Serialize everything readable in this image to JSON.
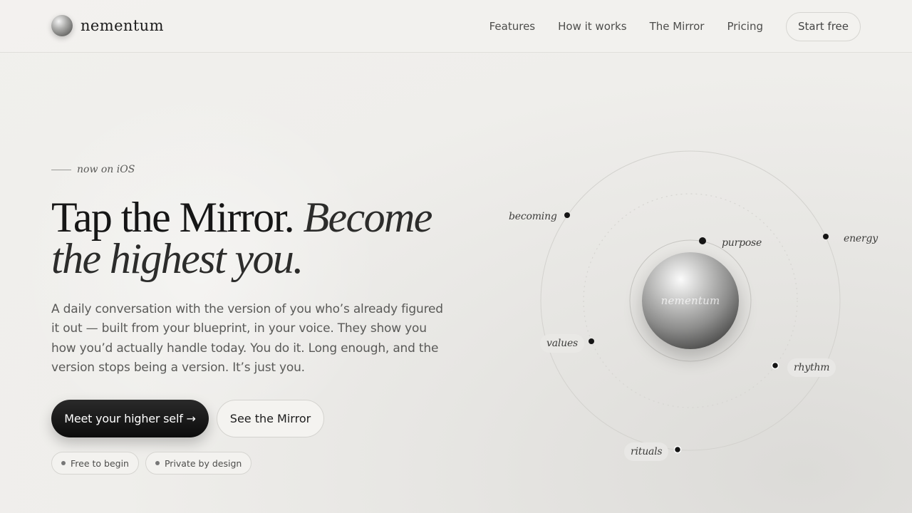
{
  "brand": {
    "name": "nementum"
  },
  "nav": {
    "links": [
      "Features",
      "How it works",
      "The Mirror",
      "Pricing"
    ],
    "cta": "Start free"
  },
  "hero": {
    "eyebrow": "now on iOS",
    "headline_plain": "Tap the Mirror.",
    "headline_italic": "Become the highest you.",
    "lede": "A daily conversation with the version of you who’s already figured it out — built from your blueprint, in your voice. They show you how you’d actually handle today. You do it. Long enough, and the version stops being a version. It’s just you.",
    "primary_cta": "Meet your higher self →",
    "secondary_cta": "See the Mirror",
    "badges": [
      "Free to begin",
      "Private by design"
    ]
  },
  "mirror": {
    "orb_label": "nementum",
    "nodes": [
      "becoming",
      "purpose",
      "energy",
      "values",
      "rhythm",
      "rituals"
    ]
  }
}
